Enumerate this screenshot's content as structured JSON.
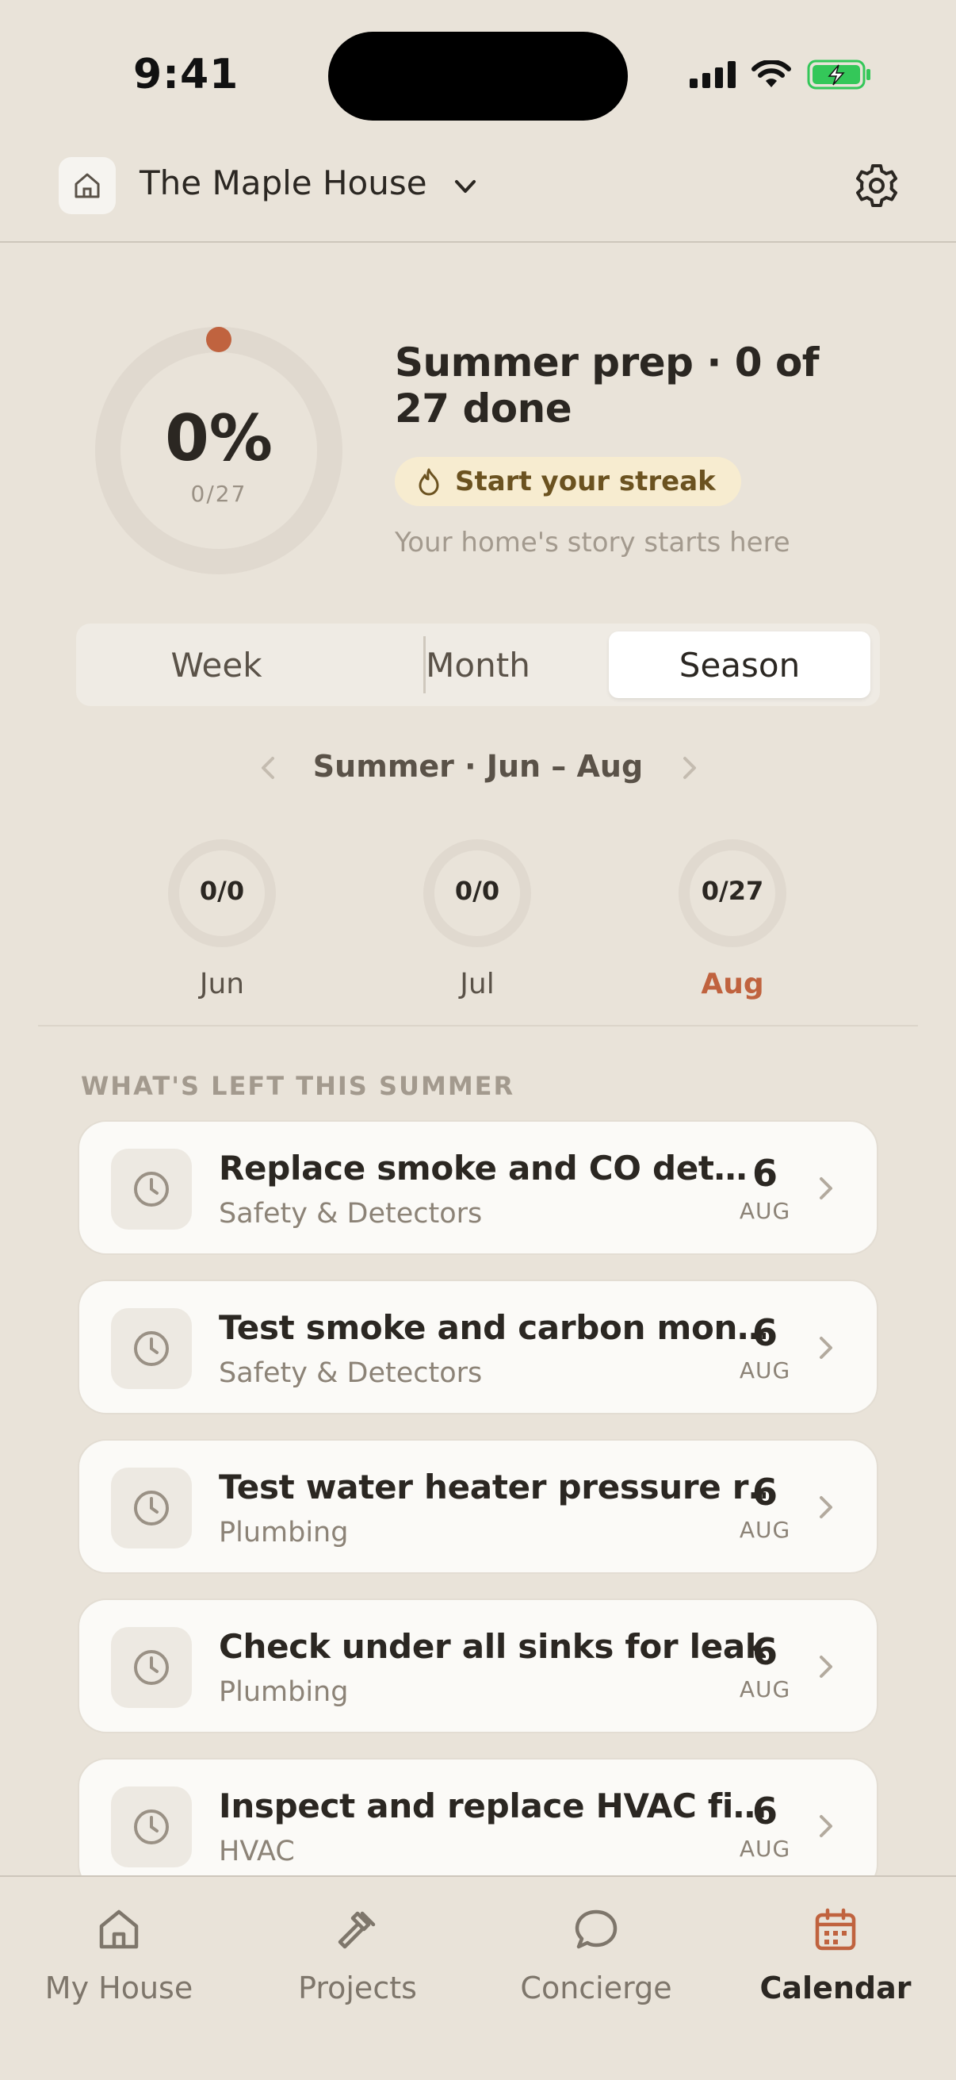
{
  "status": {
    "time": "9:41"
  },
  "header": {
    "house_name": "The Maple House"
  },
  "summary": {
    "progress_percent_label": "0%",
    "progress_count": "0/27",
    "progress_fraction": 0,
    "title": "Summer prep · 0 of 27 done",
    "streak_label": "Start your streak",
    "subtitle": "Your home's story starts here"
  },
  "segments": [
    {
      "label": "Week",
      "active": false
    },
    {
      "label": "Month",
      "active": false
    },
    {
      "label": "Season",
      "active": true
    }
  ],
  "period": {
    "label": "Summer · Jun – Aug"
  },
  "months": [
    {
      "count": "0/0",
      "label": "Jun",
      "current": false
    },
    {
      "count": "0/0",
      "label": "Jul",
      "current": false
    },
    {
      "count": "0/27",
      "label": "Aug",
      "current": true
    }
  ],
  "section_title": "WHAT'S LEFT THIS SUMMER",
  "tasks": [
    {
      "title": "Replace smoke and CO det…",
      "category": "Safety & Detectors",
      "day": "6",
      "month": "AUG",
      "icon": "clock-icon"
    },
    {
      "title": "Test smoke and carbon mon…",
      "category": "Safety & Detectors",
      "day": "6",
      "month": "AUG",
      "icon": "clock-icon"
    },
    {
      "title": "Test water heater pressure r…",
      "category": "Plumbing",
      "day": "6",
      "month": "AUG",
      "icon": "clock-icon"
    },
    {
      "title": "Check under all sinks for leaks",
      "category": "Plumbing",
      "day": "6",
      "month": "AUG",
      "icon": "clock-icon"
    },
    {
      "title": "Inspect and replace HVAC fi…",
      "category": "HVAC",
      "day": "6",
      "month": "AUG",
      "icon": "clock-icon"
    }
  ],
  "nav": [
    {
      "label": "My House",
      "icon": "house-icon",
      "active": false
    },
    {
      "label": "Projects",
      "icon": "hammer-icon",
      "active": false
    },
    {
      "label": "Concierge",
      "icon": "chat-bubble-icon",
      "active": false
    },
    {
      "label": "Calendar",
      "icon": "calendar-icon",
      "active": true
    }
  ],
  "colors": {
    "accent": "#c0633f",
    "background": "#e9e3d9",
    "card": "#fbfaf7",
    "streak_bg": "#f7ecd0"
  }
}
